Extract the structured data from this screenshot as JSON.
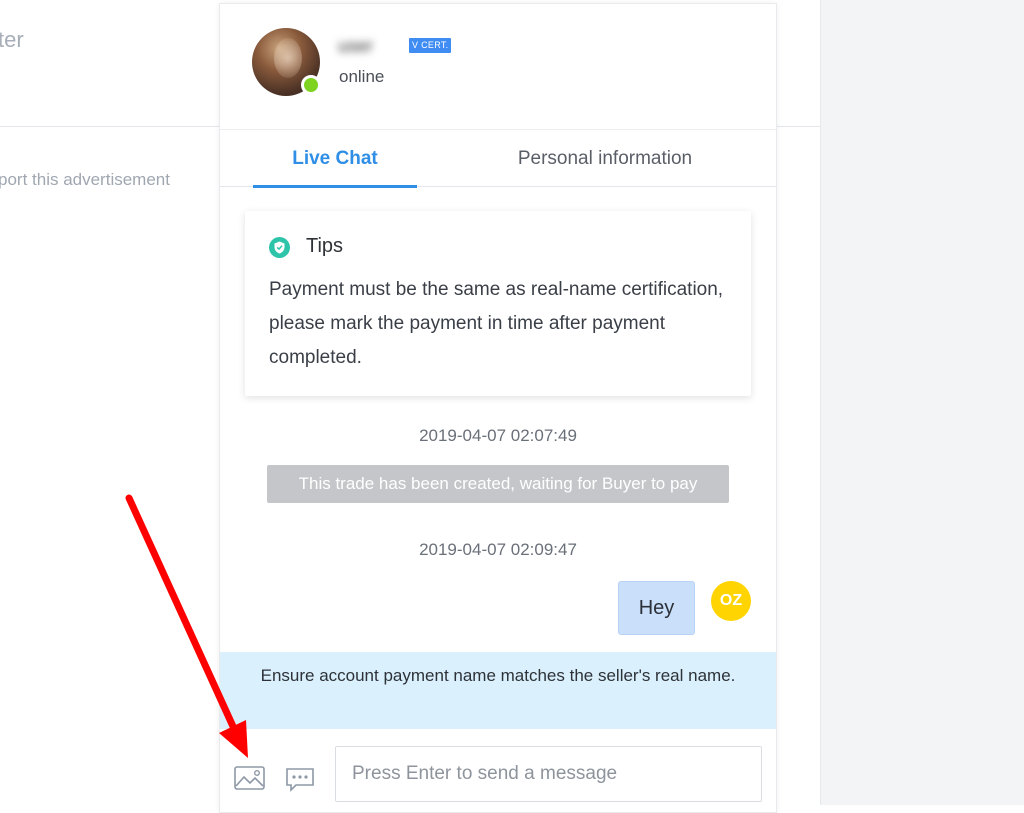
{
  "background": {
    "header_fragment": "ter",
    "report_link": "port this advertisement"
  },
  "chat": {
    "user": {
      "name": "user",
      "cert_badge": "V CERT.",
      "status": "online"
    },
    "tabs": [
      {
        "label": "Live Chat",
        "active": true
      },
      {
        "label": "Personal information",
        "active": false
      }
    ],
    "tips": {
      "title": "Tips",
      "body": "Payment must be the same as real-name certification, please mark the payment in time after payment completed."
    },
    "messages": [
      {
        "timestamp": "2019-04-07 02:07:49",
        "system_text": "This trade has been created, waiting for Buyer to pay"
      },
      {
        "timestamp": "2019-04-07 02:09:47",
        "text": "Hey",
        "avatar_initials": "OZ"
      }
    ],
    "notice": "Ensure account payment name matches the seller's real name.",
    "composer": {
      "placeholder": "Press Enter to send a message",
      "image_icon": "image-icon",
      "quick_reply_icon": "chat-bubble-icon"
    }
  },
  "colors": {
    "accent": "#2f8ee6",
    "online": "#7ed321",
    "tips_icon": "#2ec4a9",
    "system_bubble": "#c4c6c9",
    "my_bubble": "#c9dffa",
    "my_avatar": "#ffd400",
    "notice_bg": "#daf0fd",
    "annotation_arrow": "#ff0000"
  }
}
